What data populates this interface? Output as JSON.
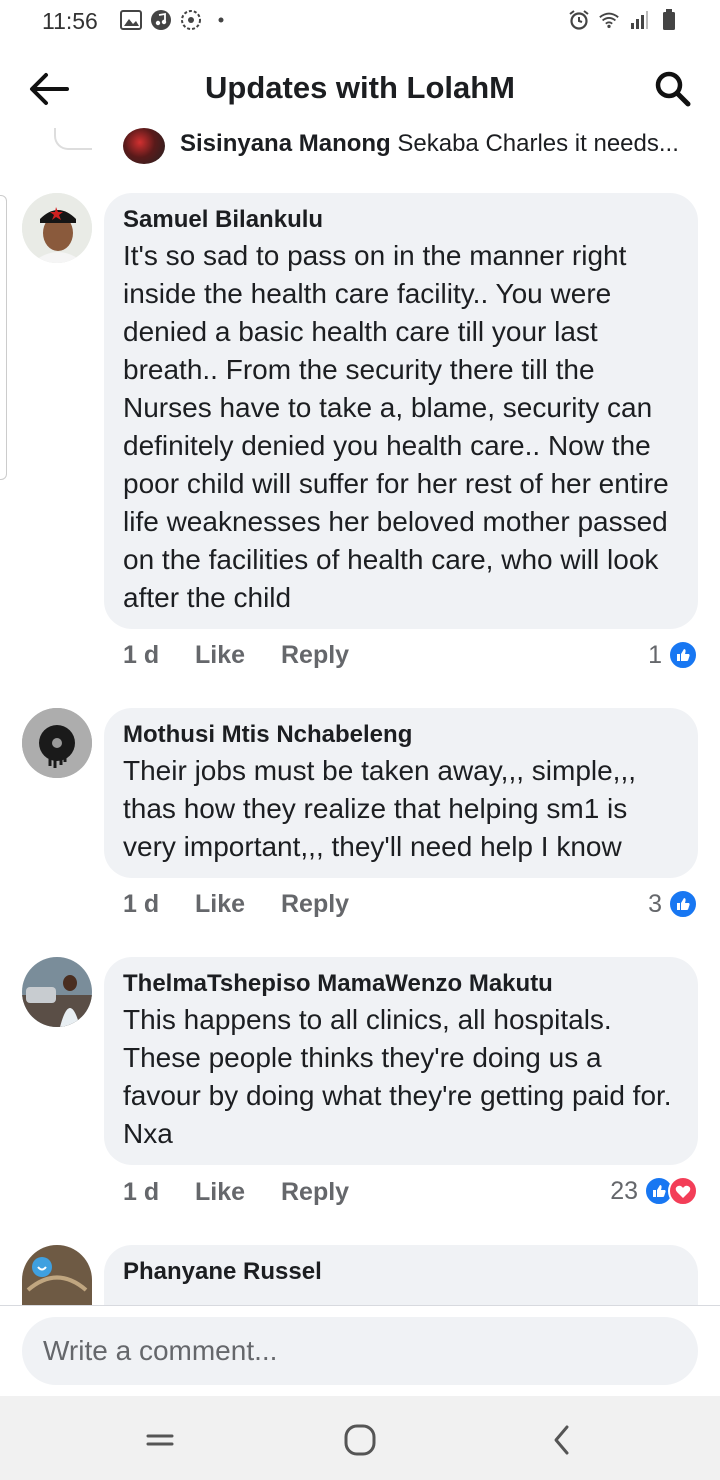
{
  "status_bar": {
    "time": "11:56",
    "left_icons": [
      "gallery-icon",
      "music-icon",
      "aperture-icon",
      "dot-icon"
    ],
    "right_icons": [
      "alarm-icon",
      "wifi-icon",
      "signal-icon",
      "battery-icon"
    ]
  },
  "header": {
    "title": "Updates with LolahM",
    "back_icon": "back-arrow-icon",
    "search_icon": "search-icon"
  },
  "top_reply": {
    "author": "Sisinyana Manong",
    "preview": "Sekaba Charles  it needs..."
  },
  "comments": [
    {
      "author": "Samuel Bilankulu",
      "text": "It's so sad to pass on in the manner right inside the health care facility.. You were denied a basic health care till your last breath.. From the security there till the Nurses have to take a, blame, security can definitely denied you health care.. Now the poor child will suffer for her rest of her entire life weaknesses her beloved mother passed on the facilities of health care, who will look after the child",
      "time": "1 d",
      "like_label": "Like",
      "reply_label": "Reply",
      "reactions_count": "1",
      "reactions": [
        "like"
      ]
    },
    {
      "author": "Mothusi Mtis Nchabeleng",
      "text": "Their jobs must be taken away,,, simple,,, thas how they realize that helping sm1 is very important,,, they'll need help I know",
      "time": "1 d",
      "like_label": "Like",
      "reply_label": "Reply",
      "reactions_count": "3",
      "reactions": [
        "like"
      ]
    },
    {
      "author": "ThelmaTshepiso MamaWenzo Makutu",
      "text": "This happens to all clinics, all hospitals. These people thinks they're doing us a favour by doing what they're getting paid for. Nxa",
      "time": "1 d",
      "like_label": "Like",
      "reply_label": "Reply",
      "reactions_count": "23",
      "reactions": [
        "like",
        "love"
      ]
    },
    {
      "author": "Phanyane Russel"
    }
  ],
  "composer": {
    "placeholder": "Write a comment..."
  },
  "nav_bar": {
    "icons": [
      "recent-apps-icon",
      "home-icon",
      "back-icon"
    ]
  },
  "colors": {
    "accent": "#1877f2",
    "love": "#f33e58",
    "bubble": "#f0f2f5",
    "secondary_text": "#65676b"
  }
}
